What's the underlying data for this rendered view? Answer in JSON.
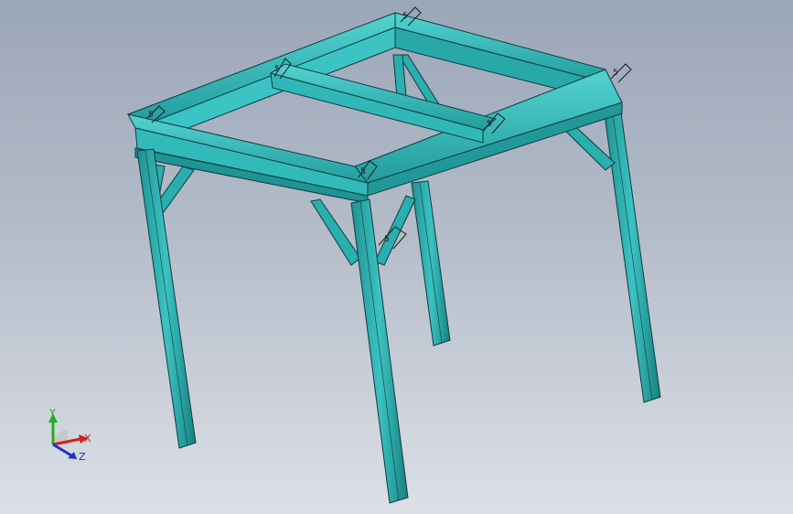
{
  "model": {
    "member_color": "#2fb5b5",
    "edge_color": "#0d3c40",
    "weld_symbol": "5"
  },
  "triad": {
    "x_label": "X",
    "y_label": "Y",
    "z_label": "Z",
    "x_color": "#d02020",
    "y_color": "#20b020",
    "z_color": "#2030c8"
  }
}
